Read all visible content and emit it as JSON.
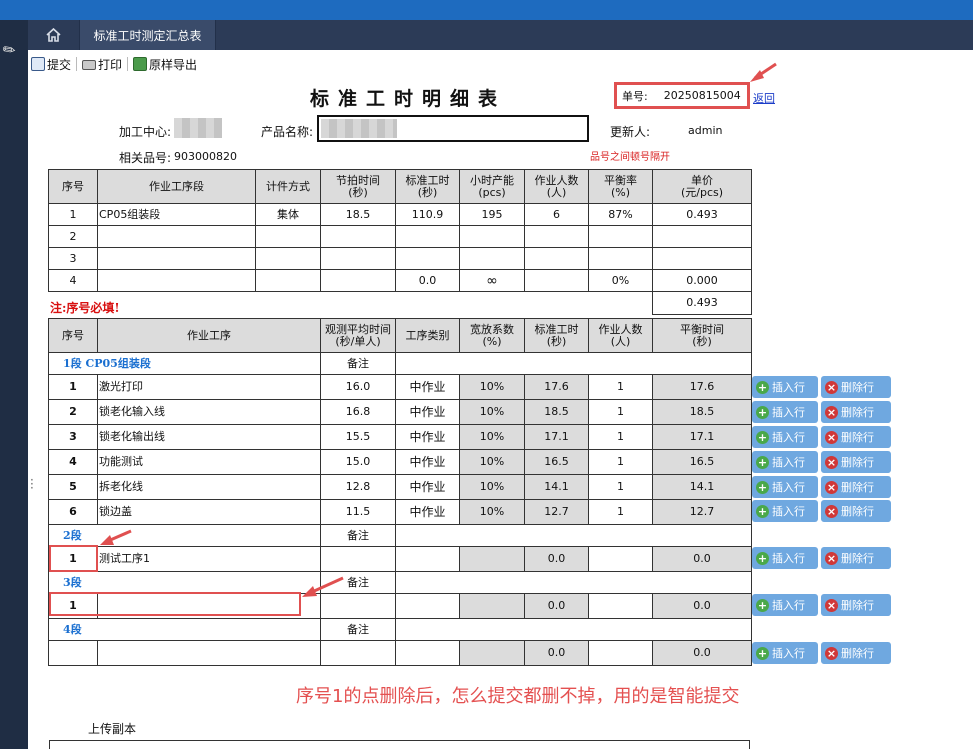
{
  "tabs": {
    "active_label": "标准工时测定汇总表"
  },
  "toolbar": {
    "submit": "提交",
    "print": "打印",
    "export": "原样导出"
  },
  "report": {
    "title": "标准工时明细表",
    "order_label": "单号:",
    "order_no": "20250815004",
    "back": "返回",
    "center_label": "加工中心:",
    "product_label": "产品名称:",
    "updater_label": "更新人:",
    "updater": "admin",
    "part_label": "相关品号:",
    "part_no": "903000820",
    "part_hint": "品号之间顿号隔开"
  },
  "summary": {
    "headers": [
      "序号",
      "作业工序段",
      "计件方式",
      "节拍时间\n(秒)",
      "标准工时\n(秒)",
      "小时产能\n(pcs)",
      "作业人数\n(人)",
      "平衡率\n(%)",
      "单价\n(元/pcs)"
    ],
    "rows": [
      [
        "1",
        "CP05组装段",
        "集体",
        "18.5",
        "110.9",
        "195",
        "6",
        "87%",
        "0.493"
      ],
      [
        "2",
        "",
        "",
        "",
        "",
        "",
        "",
        "",
        ""
      ],
      [
        "3",
        "",
        "",
        "",
        "",
        "",
        "",
        "",
        ""
      ],
      [
        "4",
        "",
        "",
        "",
        "0.0",
        "∞",
        "",
        "0%",
        "0.000"
      ]
    ],
    "required_note": "注:序号必填!",
    "total": "0.493"
  },
  "detail": {
    "headers": [
      "序号",
      "作业工序",
      "观测平均时间\n(秒/单人)",
      "工序类别",
      "宽放系数\n(%)",
      "标准工时\n(秒)",
      "作业人数\n(人)",
      "平衡时间\n(秒)"
    ],
    "remark_label": "备注",
    "segments": [
      {
        "label": "1段 CP05组装段",
        "rows": [
          [
            "1",
            "激光打印",
            "16.0",
            "中作业",
            "10%",
            "17.6",
            "1",
            "17.6"
          ],
          [
            "2",
            "锁老化输入线",
            "16.8",
            "中作业",
            "10%",
            "18.5",
            "1",
            "18.5"
          ],
          [
            "3",
            "锁老化输出线",
            "15.5",
            "中作业",
            "10%",
            "17.1",
            "1",
            "17.1"
          ],
          [
            "4",
            "功能测试",
            "15.0",
            "中作业",
            "10%",
            "16.5",
            "1",
            "16.5"
          ],
          [
            "5",
            "拆老化线",
            "12.8",
            "中作业",
            "10%",
            "14.1",
            "1",
            "14.1"
          ],
          [
            "6",
            "锁边盖",
            "11.5",
            "中作业",
            "10%",
            "12.7",
            "1",
            "12.7"
          ]
        ]
      },
      {
        "label": "2段",
        "rows": [
          [
            "1",
            "测试工序1",
            "",
            "",
            "",
            "0.0",
            "",
            "0.0"
          ]
        ]
      },
      {
        "label": "3段",
        "rows": [
          [
            "1",
            "",
            "",
            "",
            "",
            "0.0",
            "",
            "0.0"
          ]
        ]
      },
      {
        "label": "4段",
        "rows": [
          [
            "",
            "",
            "",
            "",
            "",
            "0.0",
            "",
            "0.0"
          ]
        ]
      }
    ],
    "insert_btn": "插入行",
    "delete_btn": "删除行"
  },
  "annotation": "序号1的点删除后，怎么提交都删不掉，用的是智能提交",
  "upload_label": "上传副本",
  "colors": {
    "accent_red": "#e05050",
    "segment_blue": "#1a6fd0",
    "button_blue": "#6fa8e0",
    "required_red": "#d81010"
  }
}
